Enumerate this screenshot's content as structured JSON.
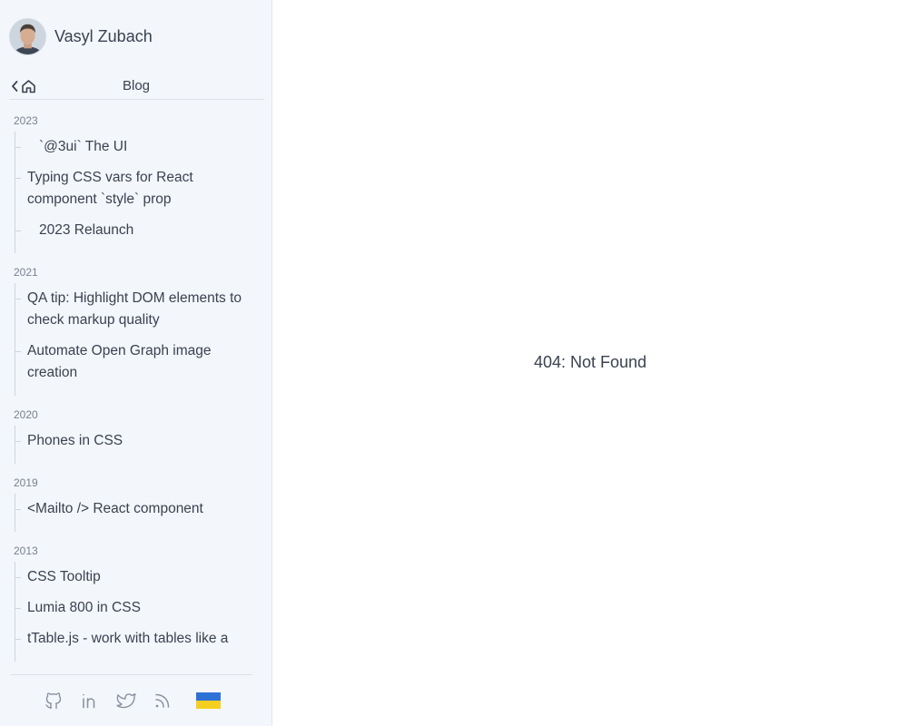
{
  "profile": {
    "name": "Vasyl Zubach"
  },
  "nav": {
    "title": "Blog"
  },
  "posts_by_year": [
    {
      "year": "2023",
      "posts": [
        {
          "title": "`@3ui` The UI",
          "indent": true
        },
        {
          "title": "Typing CSS vars for React component `style` prop",
          "indent": false
        },
        {
          "title": "2023 Relaunch",
          "indent": true
        }
      ]
    },
    {
      "year": "2021",
      "posts": [
        {
          "title": "QA tip: Highlight DOM elements to check markup quality",
          "indent": false
        },
        {
          "title": "Automate Open Graph image creation",
          "indent": false
        }
      ]
    },
    {
      "year": "2020",
      "posts": [
        {
          "title": "Phones in CSS",
          "indent": false
        }
      ]
    },
    {
      "year": "2019",
      "posts": [
        {
          "title": "<Mailto /> React component",
          "indent": false
        }
      ]
    },
    {
      "year": "2013",
      "posts": [
        {
          "title": "CSS Tooltip",
          "indent": false
        },
        {
          "title": "Lumia 800 in CSS",
          "indent": false
        },
        {
          "title": "tTable.js - work with tables like a",
          "indent": false
        }
      ]
    }
  ],
  "footer": {
    "links": [
      {
        "icon": "github-icon"
      },
      {
        "icon": "linkedin-icon"
      },
      {
        "icon": "twitter-icon"
      },
      {
        "icon": "rss-icon"
      }
    ],
    "flag_colors": [
      "#2f72d6",
      "#f5cf1f"
    ]
  },
  "main": {
    "message": "404: Not Found"
  }
}
